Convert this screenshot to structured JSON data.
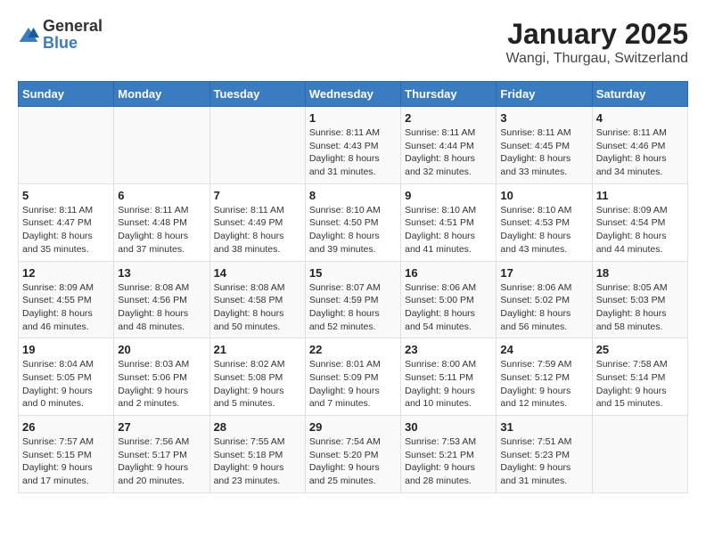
{
  "logo": {
    "general": "General",
    "blue": "Blue"
  },
  "title": "January 2025",
  "subtitle": "Wangi, Thurgau, Switzerland",
  "days_of_week": [
    "Sunday",
    "Monday",
    "Tuesday",
    "Wednesday",
    "Thursday",
    "Friday",
    "Saturday"
  ],
  "weeks": [
    {
      "days": [
        {
          "num": "",
          "info": ""
        },
        {
          "num": "",
          "info": ""
        },
        {
          "num": "",
          "info": ""
        },
        {
          "num": "1",
          "info": "Sunrise: 8:11 AM\nSunset: 4:43 PM\nDaylight: 8 hours\nand 31 minutes."
        },
        {
          "num": "2",
          "info": "Sunrise: 8:11 AM\nSunset: 4:44 PM\nDaylight: 8 hours\nand 32 minutes."
        },
        {
          "num": "3",
          "info": "Sunrise: 8:11 AM\nSunset: 4:45 PM\nDaylight: 8 hours\nand 33 minutes."
        },
        {
          "num": "4",
          "info": "Sunrise: 8:11 AM\nSunset: 4:46 PM\nDaylight: 8 hours\nand 34 minutes."
        }
      ]
    },
    {
      "days": [
        {
          "num": "5",
          "info": "Sunrise: 8:11 AM\nSunset: 4:47 PM\nDaylight: 8 hours\nand 35 minutes."
        },
        {
          "num": "6",
          "info": "Sunrise: 8:11 AM\nSunset: 4:48 PM\nDaylight: 8 hours\nand 37 minutes."
        },
        {
          "num": "7",
          "info": "Sunrise: 8:11 AM\nSunset: 4:49 PM\nDaylight: 8 hours\nand 38 minutes."
        },
        {
          "num": "8",
          "info": "Sunrise: 8:10 AM\nSunset: 4:50 PM\nDaylight: 8 hours\nand 39 minutes."
        },
        {
          "num": "9",
          "info": "Sunrise: 8:10 AM\nSunset: 4:51 PM\nDaylight: 8 hours\nand 41 minutes."
        },
        {
          "num": "10",
          "info": "Sunrise: 8:10 AM\nSunset: 4:53 PM\nDaylight: 8 hours\nand 43 minutes."
        },
        {
          "num": "11",
          "info": "Sunrise: 8:09 AM\nSunset: 4:54 PM\nDaylight: 8 hours\nand 44 minutes."
        }
      ]
    },
    {
      "days": [
        {
          "num": "12",
          "info": "Sunrise: 8:09 AM\nSunset: 4:55 PM\nDaylight: 8 hours\nand 46 minutes."
        },
        {
          "num": "13",
          "info": "Sunrise: 8:08 AM\nSunset: 4:56 PM\nDaylight: 8 hours\nand 48 minutes."
        },
        {
          "num": "14",
          "info": "Sunrise: 8:08 AM\nSunset: 4:58 PM\nDaylight: 8 hours\nand 50 minutes."
        },
        {
          "num": "15",
          "info": "Sunrise: 8:07 AM\nSunset: 4:59 PM\nDaylight: 8 hours\nand 52 minutes."
        },
        {
          "num": "16",
          "info": "Sunrise: 8:06 AM\nSunset: 5:00 PM\nDaylight: 8 hours\nand 54 minutes."
        },
        {
          "num": "17",
          "info": "Sunrise: 8:06 AM\nSunset: 5:02 PM\nDaylight: 8 hours\nand 56 minutes."
        },
        {
          "num": "18",
          "info": "Sunrise: 8:05 AM\nSunset: 5:03 PM\nDaylight: 8 hours\nand 58 minutes."
        }
      ]
    },
    {
      "days": [
        {
          "num": "19",
          "info": "Sunrise: 8:04 AM\nSunset: 5:05 PM\nDaylight: 9 hours\nand 0 minutes."
        },
        {
          "num": "20",
          "info": "Sunrise: 8:03 AM\nSunset: 5:06 PM\nDaylight: 9 hours\nand 2 minutes."
        },
        {
          "num": "21",
          "info": "Sunrise: 8:02 AM\nSunset: 5:08 PM\nDaylight: 9 hours\nand 5 minutes."
        },
        {
          "num": "22",
          "info": "Sunrise: 8:01 AM\nSunset: 5:09 PM\nDaylight: 9 hours\nand 7 minutes."
        },
        {
          "num": "23",
          "info": "Sunrise: 8:00 AM\nSunset: 5:11 PM\nDaylight: 9 hours\nand 10 minutes."
        },
        {
          "num": "24",
          "info": "Sunrise: 7:59 AM\nSunset: 5:12 PM\nDaylight: 9 hours\nand 12 minutes."
        },
        {
          "num": "25",
          "info": "Sunrise: 7:58 AM\nSunset: 5:14 PM\nDaylight: 9 hours\nand 15 minutes."
        }
      ]
    },
    {
      "days": [
        {
          "num": "26",
          "info": "Sunrise: 7:57 AM\nSunset: 5:15 PM\nDaylight: 9 hours\nand 17 minutes."
        },
        {
          "num": "27",
          "info": "Sunrise: 7:56 AM\nSunset: 5:17 PM\nDaylight: 9 hours\nand 20 minutes."
        },
        {
          "num": "28",
          "info": "Sunrise: 7:55 AM\nSunset: 5:18 PM\nDaylight: 9 hours\nand 23 minutes."
        },
        {
          "num": "29",
          "info": "Sunrise: 7:54 AM\nSunset: 5:20 PM\nDaylight: 9 hours\nand 25 minutes."
        },
        {
          "num": "30",
          "info": "Sunrise: 7:53 AM\nSunset: 5:21 PM\nDaylight: 9 hours\nand 28 minutes."
        },
        {
          "num": "31",
          "info": "Sunrise: 7:51 AM\nSunset: 5:23 PM\nDaylight: 9 hours\nand 31 minutes."
        },
        {
          "num": "",
          "info": ""
        }
      ]
    }
  ]
}
